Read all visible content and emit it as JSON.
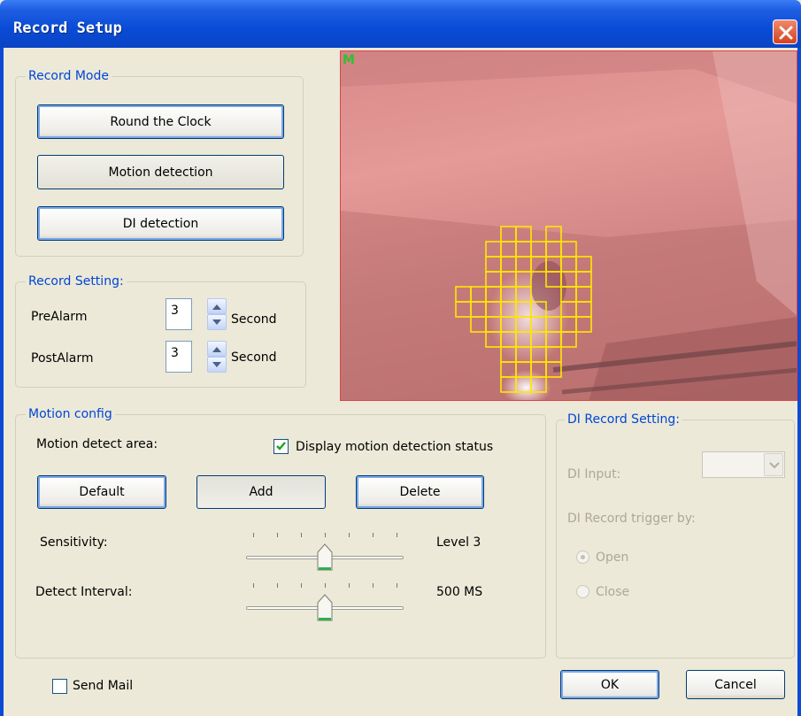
{
  "window": {
    "title": "Record Setup"
  },
  "record_mode": {
    "legend": "Record Mode",
    "buttons": [
      "Round the Clock",
      "Motion detection",
      "DI detection"
    ]
  },
  "record_setting": {
    "legend": "Record Setting:",
    "rows": [
      {
        "label": "PreAlarm",
        "value": "3",
        "unit": "Second"
      },
      {
        "label": "PostAlarm",
        "value": "3",
        "unit": "Second"
      }
    ]
  },
  "video": {
    "overlay_label": "M",
    "overlay_color": "#2ec12e",
    "grid_color": "#ffe600"
  },
  "motion_config": {
    "legend": "Motion config",
    "area_label": "Motion detect area:",
    "display_status_label": "Display motion detection status",
    "display_status_checked": true,
    "buttons": {
      "default": "Default",
      "add": "Add",
      "delete": "Delete"
    },
    "sensitivity": {
      "label": "Sensitivity:",
      "value_text": "Level 3",
      "level": 3,
      "max": 6
    },
    "detect_interval": {
      "label": "Detect Interval:",
      "value_text": "500 MS",
      "step": 3,
      "max": 6
    }
  },
  "di_record": {
    "legend": "DI Record Setting:",
    "input_label": "DI Input:",
    "input_value": "",
    "trigger_label": "DI Record trigger by:",
    "options": [
      "Open",
      "Close"
    ],
    "selected": "Open"
  },
  "footer": {
    "send_mail_label": "Send Mail",
    "send_mail_checked": false,
    "ok_label": "OK",
    "cancel_label": "Cancel"
  },
  "colors": {
    "title_bar": "#0a4bd6",
    "legend_text": "#0046d5",
    "close_red": "#d6411e"
  }
}
